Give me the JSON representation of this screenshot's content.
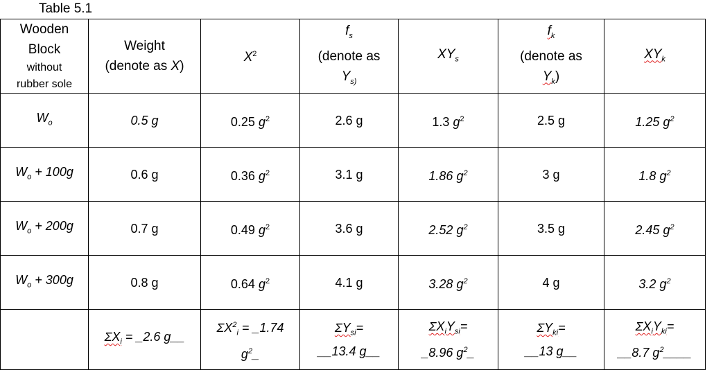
{
  "caption": "Table 5.1",
  "header": {
    "col0": {
      "line1": "Wooden",
      "line2": "Block",
      "line3": "without",
      "line4": "rubber sole"
    },
    "col1": {
      "line1": "Weight",
      "line2_prefix": "(denote as ",
      "line2_var": "X",
      "line2_suffix": ")"
    },
    "col2": {
      "base": "X",
      "sup": "2"
    },
    "col3": {
      "f": "f",
      "f_sub": "s",
      "line2": "(denote as",
      "y": "Y",
      "y_sub": "s)"
    },
    "col4": {
      "base": "XY",
      "sub": "s"
    },
    "col5": {
      "f": "f",
      "f_sub": "k",
      "line2": "(denote as",
      "y": "Y",
      "y_sub": "k",
      "close": ")"
    },
    "col6": {
      "base": "XY",
      "sub": "k"
    }
  },
  "rows": [
    {
      "label_base": "W",
      "label_sub": "o",
      "label_rest": "",
      "weight": "0.5 g",
      "x2_num": "0.25 ",
      "x2_unit": "g",
      "fs": "2.6 g",
      "xys_num": "1.3 ",
      "xys_unit": "g",
      "fk": "2.5 g",
      "xyk_num": "1.25 ",
      "xyk_unit": "g"
    },
    {
      "label_base": "W",
      "label_sub": "o",
      "label_rest": " + 100g",
      "weight": "0.6 g",
      "x2_num": "0.36 ",
      "x2_unit": "g",
      "fs": "3.1 g",
      "xys_num": "1.86 ",
      "xys_unit": "g",
      "fk": "3 g",
      "xyk_num": "1.8 ",
      "xyk_unit": "g"
    },
    {
      "label_base": "W",
      "label_sub": "o",
      "label_rest": " + 200g",
      "weight": "0.7 g",
      "x2_num": "0.49 ",
      "x2_unit": "g",
      "fs": "3.6 g",
      "xys_num": "2.52 ",
      "xys_unit": "g",
      "fk": "3.5 g",
      "xyk_num": "2.45 ",
      "xyk_unit": "g"
    },
    {
      "label_base": "W",
      "label_sub": "o",
      "label_rest": " + 300g",
      "weight": "0.8 g",
      "x2_num": "0.64 ",
      "x2_unit": "g",
      "fs": "4.1 g",
      "xys_num": "3.28 ",
      "xys_unit": "g",
      "fk": "4 g",
      "xyk_num": "3.2 ",
      "xyk_unit": "g"
    }
  ],
  "sums": {
    "sum_x": {
      "sigma": "ΣX",
      "sub": "i",
      "rest": " = _2.6 g__"
    },
    "sum_x2": {
      "sigma": "ΣX",
      "sup": "2",
      "sub": "i",
      "rest": " = _1.74",
      "line2": "g",
      "line2_sup": "2",
      "line2_rest": "_"
    },
    "sum_ys": {
      "sigma": "ΣY",
      "sub": "si",
      "eq": "=",
      "line2": "__13.4 g__"
    },
    "sum_xys": {
      "sigma": "ΣX",
      "sub1": "i",
      "y": "Y",
      "sub2": "si",
      "eq": "=",
      "line2": "_8.96 g",
      "line2_sup": "2",
      "line2_rest": "_"
    },
    "sum_yk": {
      "sigma": "ΣY",
      "sub": "ki",
      "eq": "=",
      "line2": "__13 g__"
    },
    "sum_xyk": {
      "sigma": "ΣX",
      "sub1": "i",
      "y": "Y",
      "sub2": "ki",
      "eq": "=",
      "line2": "__8.7 g",
      "line2_sup": "2",
      "line2_rest": "____"
    }
  }
}
